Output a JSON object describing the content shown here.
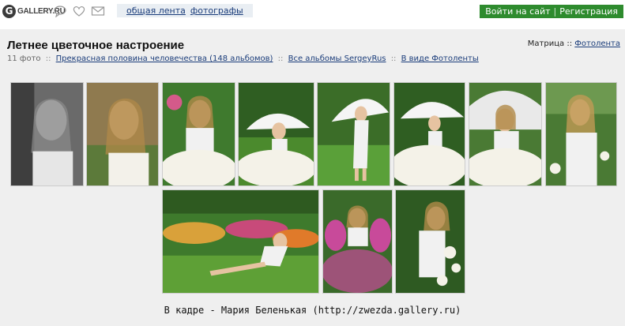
{
  "header": {
    "logo_letter": "G",
    "logo_text": "GALLERY.RU",
    "icons": [
      "chat-bubble-icon",
      "heart-icon",
      "mail-icon"
    ],
    "nav": [
      {
        "label": "общая лента"
      },
      {
        "label": "фотографы"
      }
    ],
    "auth": {
      "login_label": "Войти на сайт",
      "separator": "|",
      "register_label": "Регистрация"
    }
  },
  "album": {
    "title": "Летнее цветочное настроение",
    "photo_count": "11 фото",
    "sep": "::",
    "breadcrumb_parent": "Прекрасная половина человечества (148 альбомов)",
    "breadcrumb_all": "Все альбомы SergeyRus",
    "breadcrumb_view": "В виде Фотоленты",
    "view_mode_current": "Матрица",
    "view_mode_sep": "::",
    "view_mode_alt": "Фотолента"
  },
  "caption": "В кадре - Мария Беленькая (http://zwezda.gallery.ru)",
  "colors": {
    "accent_green": "#2e8b2e",
    "link_blue": "#1a3c7a",
    "panel_bg": "#efefef"
  }
}
